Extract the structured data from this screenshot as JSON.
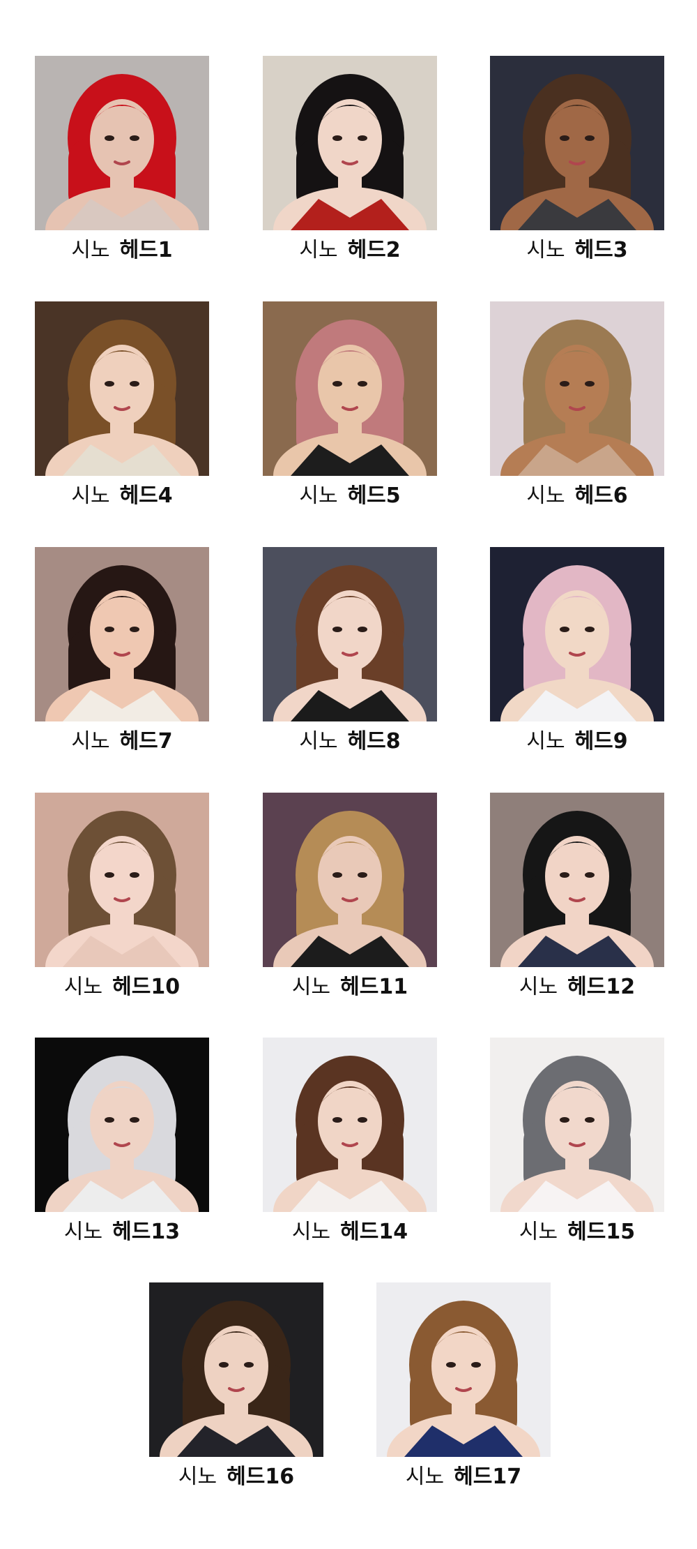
{
  "gallery": {
    "brand_label": "시노",
    "heads": [
      {
        "label": "헤드1",
        "hair": "#c8101a",
        "bg": "#b9b4b2",
        "skin": "#e6c3b2",
        "outfit": "#d9c8c0"
      },
      {
        "label": "헤드2",
        "hair": "#151213",
        "bg": "#d8d1c7",
        "skin": "#f0d6c8",
        "outfit": "#b3201c"
      },
      {
        "label": "헤드3",
        "hair": "#4a3020",
        "bg": "#2b2e3c",
        "skin": "#a06846",
        "outfit": "#3a3a3e"
      },
      {
        "label": "헤드4",
        "hair": "#7a5028",
        "bg": "#4a3426",
        "skin": "#efd0bd",
        "outfit": "#e5ded0"
      },
      {
        "label": "헤드5",
        "hair": "#c07a7c",
        "bg": "#8a6a4e",
        "skin": "#e9c6aa",
        "outfit": "#1d1d1d"
      },
      {
        "label": "헤드6",
        "hair": "#9b7a52",
        "bg": "#ddd2d6",
        "skin": "#b57d54",
        "outfit": "#c9a58a"
      },
      {
        "label": "헤드7",
        "hair": "#261714",
        "bg": "#a68c84",
        "skin": "#efc8b2",
        "outfit": "#f2ece4"
      },
      {
        "label": "헤드8",
        "hair": "#6a3f28",
        "bg": "#4c4f5d",
        "skin": "#f1d6c8",
        "outfit": "#1b1b1b"
      },
      {
        "label": "헤드9",
        "hair": "#e2b7c5",
        "bg": "#1e2133",
        "skin": "#f1d8c6",
        "outfit": "#f3f3f5"
      },
      {
        "label": "헤드10",
        "hair": "#6d5036",
        "bg": "#cfa99a",
        "skin": "#f3d6ca",
        "outfit": "#e8c8ba"
      },
      {
        "label": "헤드11",
        "hair": "#b58c56",
        "bg": "#5b4150",
        "skin": "#e9c9b8",
        "outfit": "#1c1c1c"
      },
      {
        "label": "헤드12",
        "hair": "#161616",
        "bg": "#8f7f7a",
        "skin": "#f1d4c6",
        "outfit": "#293049"
      },
      {
        "label": "헤드13",
        "hair": "#d9d9dd",
        "bg": "#0b0b0b",
        "skin": "#efd3c5",
        "outfit": "#ededed"
      },
      {
        "label": "헤드14",
        "hair": "#5a3422",
        "bg": "#ececef",
        "skin": "#f0d5c6",
        "outfit": "#f4f0ee"
      },
      {
        "label": "헤드15",
        "hair": "#6c6d72",
        "bg": "#f1efee",
        "skin": "#f1d8cc",
        "outfit": "#f7f3f3"
      },
      {
        "label": "헤드16",
        "hair": "#3a2618",
        "bg": "#1f1f22",
        "skin": "#eed2c2",
        "outfit": "#23232a"
      },
      {
        "label": "헤드17",
        "hair": "#8a5a32",
        "bg": "#ededf0",
        "skin": "#f2d6c6",
        "outfit": "#1f2f6a"
      }
    ]
  }
}
